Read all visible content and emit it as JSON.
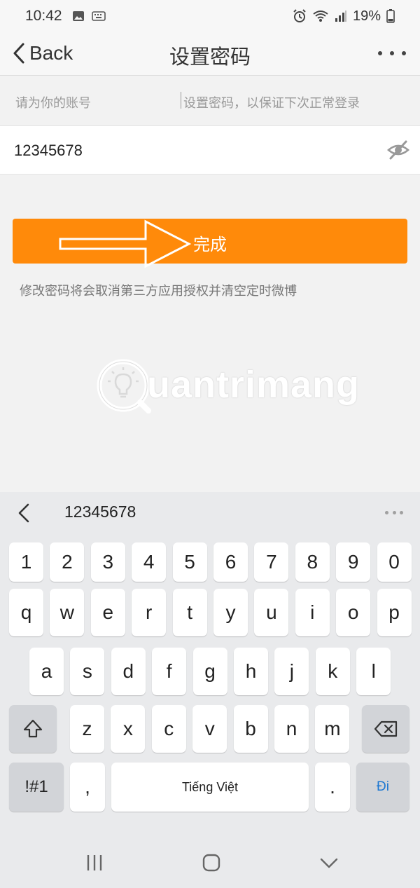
{
  "status_bar": {
    "time": "10:42",
    "battery_percent": "19%"
  },
  "nav": {
    "back_label": "Back",
    "title": "设置密码"
  },
  "hint": {
    "left_text": "请为你的账号",
    "right_text": "设置密码，以保证下次正常登录"
  },
  "password": {
    "value": "12345678",
    "visibility": "hidden"
  },
  "done_button": {
    "label": "完成",
    "color": "#ff8a0a"
  },
  "notice": "修改密码将会取消第三方应用授权并清空定时微博",
  "watermark": {
    "text": "uantrimang"
  },
  "keyboard": {
    "suggestion": "12345678",
    "rows": [
      [
        "1",
        "2",
        "3",
        "4",
        "5",
        "6",
        "7",
        "8",
        "9",
        "0"
      ],
      [
        "q",
        "w",
        "e",
        "r",
        "t",
        "y",
        "u",
        "i",
        "o",
        "p"
      ],
      [
        "a",
        "s",
        "d",
        "f",
        "g",
        "h",
        "j",
        "k",
        "l"
      ],
      [
        "z",
        "x",
        "c",
        "v",
        "b",
        "n",
        "m"
      ]
    ],
    "symbols_label": "!#1",
    "comma_label": ",",
    "space_label": "Tiếng Việt",
    "period_label": ".",
    "enter_label": "Đi"
  }
}
